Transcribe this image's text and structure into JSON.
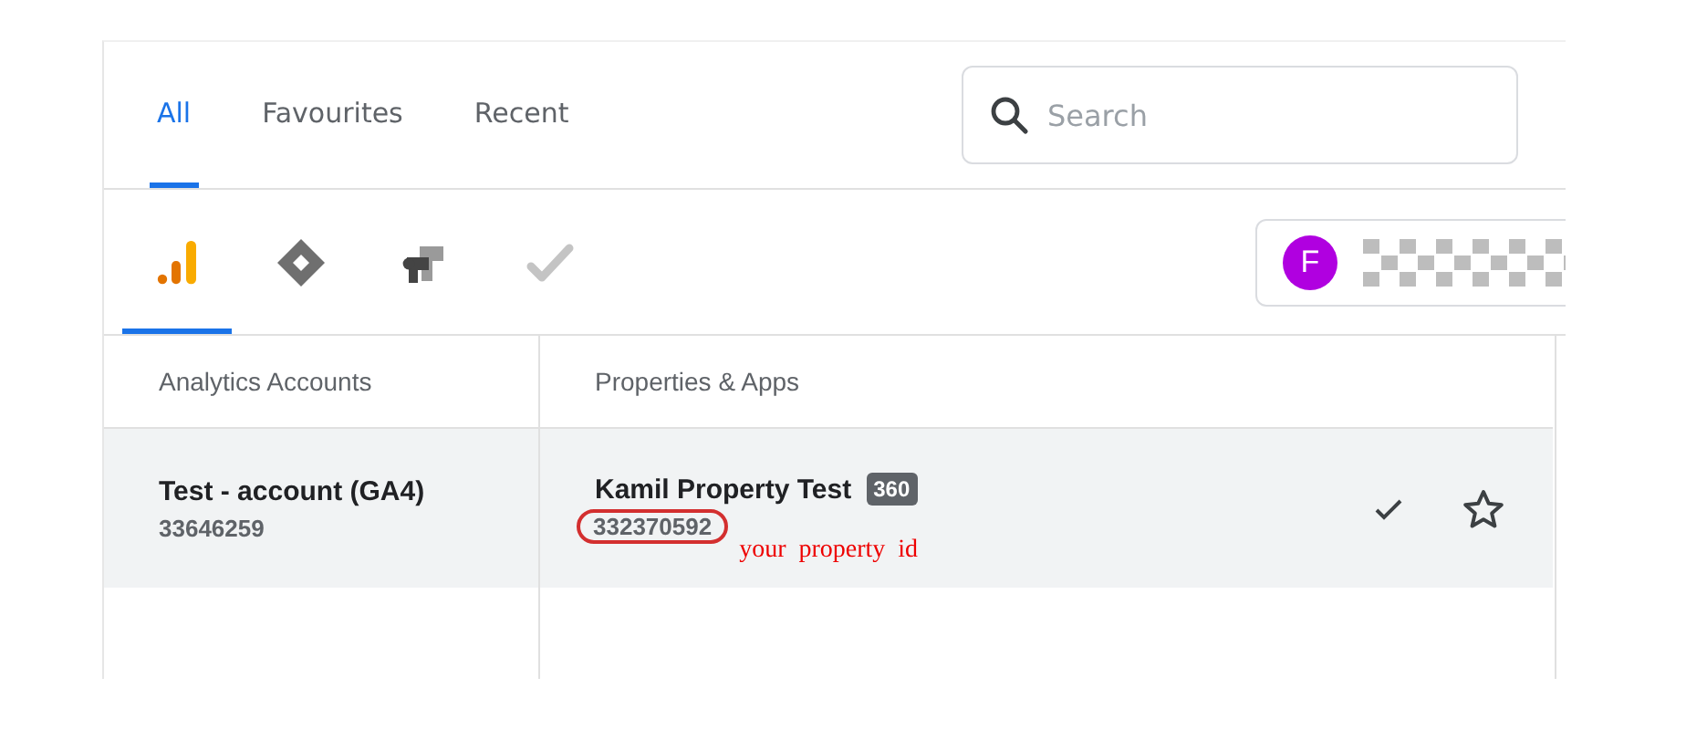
{
  "tabs": [
    {
      "label": "All",
      "selected": true
    },
    {
      "label": "Favourites",
      "selected": false
    },
    {
      "label": "Recent",
      "selected": false
    }
  ],
  "search": {
    "placeholder": "Search"
  },
  "products": [
    {
      "kind": "analytics",
      "selected": true
    },
    {
      "kind": "tagmanager",
      "selected": false
    },
    {
      "kind": "optimize",
      "selected": false
    },
    {
      "kind": "surveys",
      "selected": false
    }
  ],
  "account_chip": {
    "avatar_letter": "F"
  },
  "columns": [
    "Analytics Accounts",
    "Properties & Apps"
  ],
  "rows": [
    {
      "account_name": "Test - account (GA4)",
      "account_id": "33646259",
      "property_name": "Kamil Property Test",
      "property_badge": "360",
      "property_id": "332370592",
      "selected": true
    }
  ],
  "annotation": {
    "text": "your  property  id"
  }
}
